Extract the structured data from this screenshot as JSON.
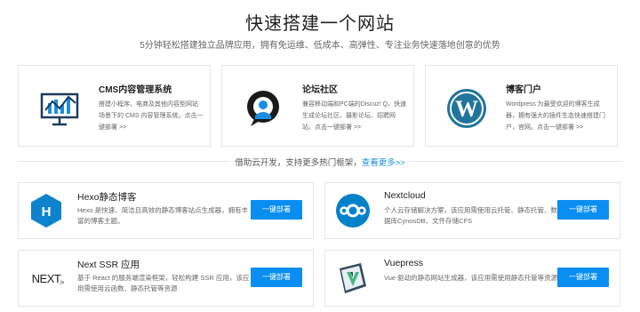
{
  "page": {
    "title": "快速搭建一个网站",
    "subtitle": "5分钟轻松搭建独立品牌应用，拥有免运维、低成本、高弹性、专注业务快速落地创意的优势"
  },
  "top_cards": [
    {
      "name": "CMS内容管理系统",
      "desc": "搭建小程序、电商及其他内容型网站场景下的 CMS 内容管理系统。点击一键部署 >>",
      "icon": "cms-chart-icon"
    },
    {
      "name": "论坛社区",
      "desc": "兼容移动端和PC端的Discuz! Q，快速生成论坛社区、摄影论坛、招聘网站。点击一键部署 >>",
      "icon": "discuz-icon"
    },
    {
      "name": "博客门户",
      "desc": "Wordpress 为最受欢迎的博客生成器，拥有强大的插件生态快速搭建门户，官网。点击一键部署 >>",
      "icon": "wordpress-icon"
    }
  ],
  "divider": {
    "text": "借助云开发，支持更多热门框架，",
    "link": "查看更多>>"
  },
  "frameworks": [
    {
      "name": "Hexo静态博客",
      "desc": "Hexo 是快速、简洁且高效的静态博客站点生成器，拥有丰富的博客主题。",
      "button": "一键部署",
      "icon": "hexo-icon"
    },
    {
      "name": "Nextcloud",
      "desc": "个人云存储解决方案，该应用需使用云托管、静态托管、数据库CynosDB、文件存储CFS",
      "button": "一键部署",
      "icon": "nextcloud-icon"
    },
    {
      "name": "Next SSR 应用",
      "desc": "基于 React 的服务端渲染框架，轻松构建 SSR 应用，该应用需使用云函数、静态托管等资源",
      "button": "一键部署",
      "icon": "nextjs-icon"
    },
    {
      "name": "Vuepress",
      "desc": "Vue 驱动的静态网站生成器，该应用需使用静态托管等资源",
      "button": "一键部署",
      "icon": "vuepress-icon"
    }
  ],
  "colors": {
    "accent": "#0a8ef2",
    "link": "#1a8fe3",
    "hexo": "#0e83cd",
    "wordpress": "#21759b",
    "nextcloud": "#0082c9",
    "vue_green": "#42b883"
  }
}
